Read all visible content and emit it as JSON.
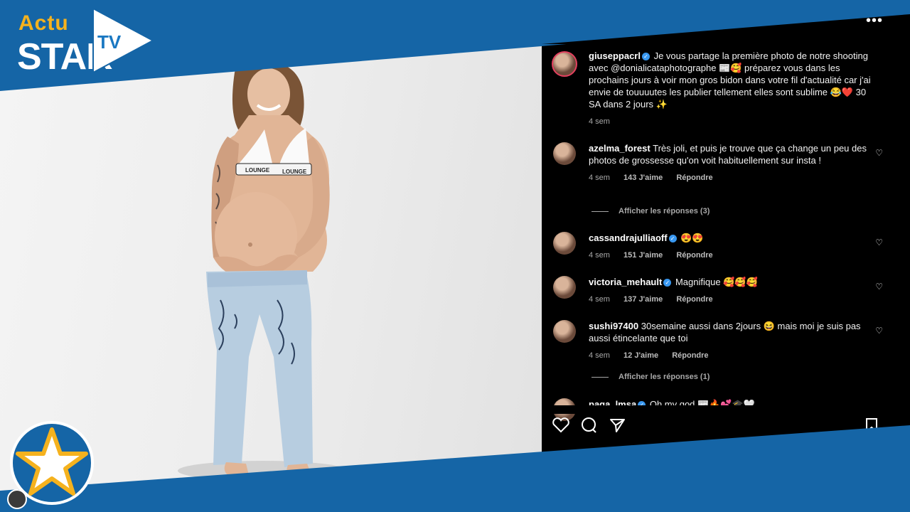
{
  "brand": {
    "actu": "Actu",
    "star": "STAR",
    "tv": "TV",
    "gold": "#f5b21e",
    "blue": "#1565a6"
  },
  "post": {
    "username": "giuseppacrl",
    "caption": "Je vous partage la première photo de notre shooting avec @donialicataphotographe 📰🥰 préparez vous dans les prochains jours à voir mon gros bidon dans votre fil d'actualité car j'ai envie de touuuutes les publier tellement elles sont sublime 😂❤️ 30 SA dans 2 jours ✨",
    "time": "4 sem"
  },
  "comments": [
    {
      "username": "azelma_forest",
      "verified": false,
      "text": "Très joli, et puis je trouve que ça change un peu des photos de grossesse qu'on voit habituellement sur insta !",
      "time": "4 sem",
      "likes": "143 J'aime",
      "reply": "Répondre",
      "show_replies": "Afficher les réponses (3)"
    },
    {
      "username": "cassandrajulliaoff",
      "verified": true,
      "text": "😍😍",
      "time": "4 sem",
      "likes": "151 J'aime",
      "reply": "Répondre"
    },
    {
      "username": "victoria_mehault",
      "verified": true,
      "text": "Magnifique 🥰🥰🥰",
      "time": "4 sem",
      "likes": "137 J'aime",
      "reply": "Répondre"
    },
    {
      "username": "sushi97400",
      "verified": false,
      "text": "30semaine aussi dans 2jours 😆 mais moi je suis pas aussi étincelante que toi",
      "time": "4 sem",
      "likes": "12 J'aime",
      "reply": "Répondre",
      "show_replies": "Afficher les réponses (1)"
    },
    {
      "username": "paga_lmsa",
      "verified": true,
      "text": "Oh my god 📰🔥💕🎓🤍"
    }
  ],
  "icons": [
    "more-icon",
    "heart-icon",
    "comment-icon",
    "share-icon",
    "bookmark-icon"
  ],
  "bra_text": "LOUNGE"
}
